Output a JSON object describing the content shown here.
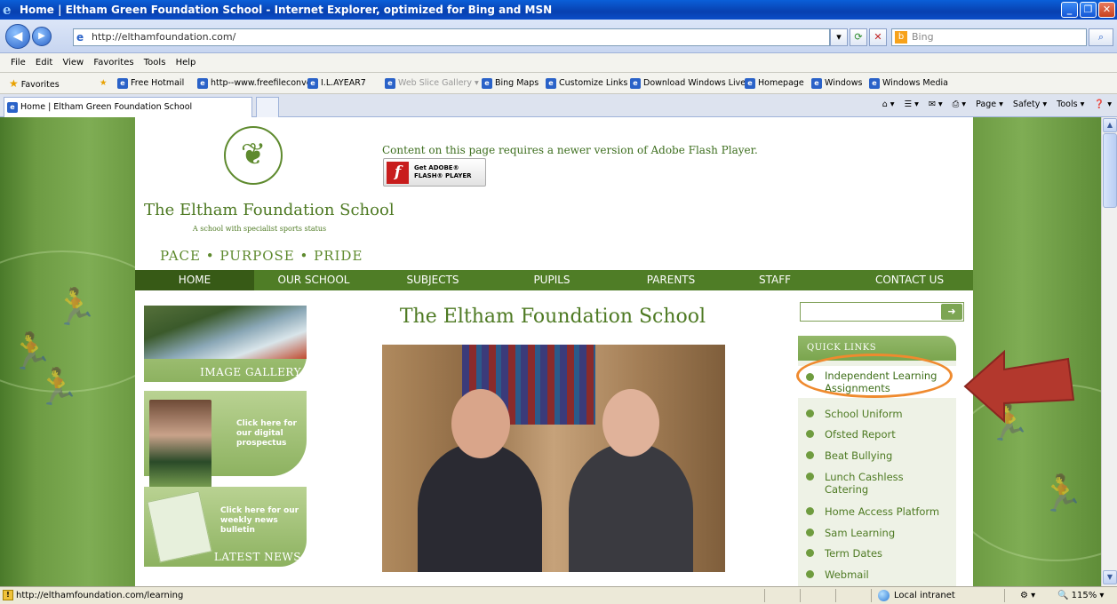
{
  "window": {
    "title": "Home | Eltham Green Foundation School - Internet Explorer, optimized for Bing and MSN",
    "minimize": "_",
    "maximize": "❐",
    "close": "✕"
  },
  "navigation": {
    "back": "◀",
    "forward": "▶",
    "address": "http://elthamfoundation.com/",
    "search_placeholder": "Bing"
  },
  "menu": [
    "File",
    "Edit",
    "View",
    "Favorites",
    "Tools",
    "Help"
  ],
  "favorites": {
    "label": "Favorites",
    "items": [
      "Free Hotmail",
      "http--www.freefileconvert",
      "I.L.AYEAR7",
      "Web Slice Gallery ▾",
      "Bing Maps",
      "Customize Links",
      "Download Windows Live",
      "Homepage",
      "Windows",
      "Windows Media"
    ]
  },
  "tab": {
    "label": "Home | Eltham Green Foundation School"
  },
  "commandbar": [
    "Page ▾",
    "Safety ▾",
    "Tools ▾",
    "❓ ▾"
  ],
  "site": {
    "school_name": "The Eltham Foundation School",
    "tagline": "A school with specialist sports status",
    "motto": "PACE • PURPOSE • PRIDE",
    "flash_message": "Content on this page requires a newer version of Adobe Flash Player.",
    "flash_button_line1": "Get ADOBE®",
    "flash_button_line2": "FLASH® PLAYER",
    "nav": [
      "HOME",
      "OUR SCHOOL",
      "SUBJECTS",
      "PUPILS",
      "PARENTS",
      "STAFF",
      "CONTACT US"
    ],
    "main_title": "The Eltham Foundation School",
    "cards": {
      "gallery_label": "IMAGE GALLERY",
      "prospectus_cta": "Click here for our digital prospectus",
      "news_cta": "Click here for our weekly news bulletin",
      "news_label": "LATEST NEWS"
    },
    "search_button": "➜",
    "quick_links_title": "QUICK LINKS",
    "quick_links": [
      "Independent Learning Assignments",
      "School Uniform",
      "Ofsted Report",
      "Beat Bullying",
      "Lunch Cashless Catering",
      "Home Access Platform",
      "Sam Learning",
      "Term Dates",
      "Webmail"
    ]
  },
  "status": {
    "url": "http://elthamfoundation.com/learning",
    "zone": "Local intranet",
    "zoom": "115%"
  },
  "colors": {
    "brand_green": "#4f7d26",
    "highlight_ring": "#ef8a2e",
    "annotation_arrow": "#b3382d"
  }
}
